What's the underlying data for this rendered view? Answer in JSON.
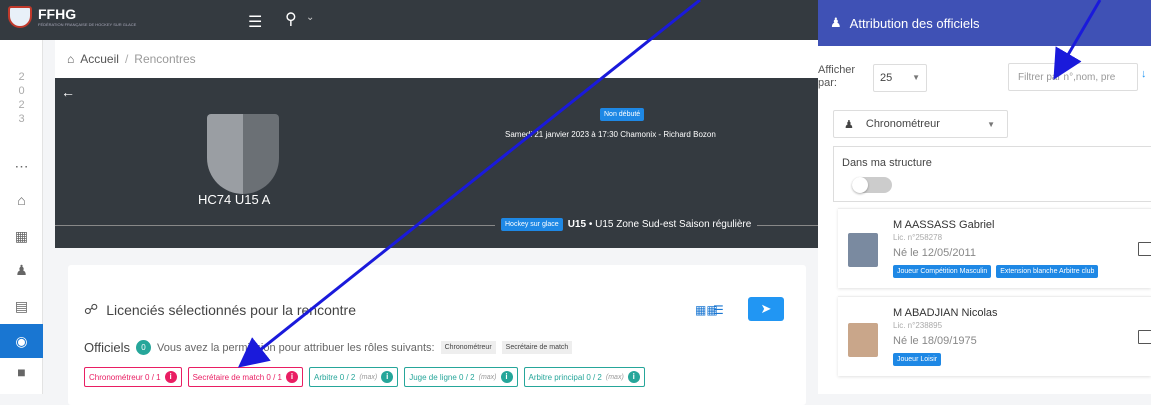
{
  "topbar": {
    "brand": "FFHG",
    "brand_sub": "FÉDÉRATION FRANÇAISE DE HOCKEY SUR GLACE"
  },
  "sidebar": {
    "year_digits": [
      "2",
      "0",
      "2",
      "3"
    ]
  },
  "breadcrumb": {
    "home": "Accueil",
    "separator": "/",
    "current": "Rencontres"
  },
  "match": {
    "status": "Non débuté",
    "info": "Samedi 21 janvier 2023 à 17:30 Chamonix - Richard Bozon",
    "team": "HC74 U15 A",
    "sport": "Hockey sur glace",
    "category_bold": "U15",
    "category_rest": " • U15 Zone Sud-est Saison régulière"
  },
  "card": {
    "title": "Licenciés sélectionnés pour la rencontre",
    "officiels_label": "Officiels",
    "officiels_count": "0",
    "permission_text": "Vous avez la permission pour attribuer les rôles suivants:",
    "allowed_roles": [
      "Chronométreur",
      "Secrétaire de match"
    ],
    "roles": [
      {
        "label": "Chronométreur 0 / 1",
        "max": "",
        "color": "red"
      },
      {
        "label": "Secrétaire de match 0 / 1",
        "max": "",
        "color": "red"
      },
      {
        "label": "Arbitre 0 / 2",
        "max": "(max)",
        "color": "teal"
      },
      {
        "label": "Juge de ligne 0 / 2",
        "max": "(max)",
        "color": "teal"
      },
      {
        "label": "Arbitre principal 0 / 2",
        "max": "(max)",
        "color": "teal"
      }
    ]
  },
  "panel": {
    "title": "Attribution des officiels",
    "afficher_label": "Afficher par:",
    "per_page": "25",
    "filter_placeholder": "Filtrer par n°,nom, pre",
    "role_select": "Chronométreur",
    "structure_label": "Dans ma structure",
    "toggle_on": false,
    "people": [
      {
        "name": "M AASSASS Gabriel",
        "lic": "Lic. n°258278",
        "born": "Né le 12/05/2011",
        "badges": [
          "Joueur Compétition Masculin",
          "Extension blanche Arbitre club"
        ]
      },
      {
        "name": "M ABADJIAN Nicolas",
        "lic": "Lic. n°238895",
        "born": "Né le 18/09/1975",
        "badges": [
          "Joueur Loisir"
        ]
      }
    ]
  },
  "colors": {
    "accent": "#1e88e5",
    "panel_header": "#3f51b5",
    "dark": "#343a40",
    "arrow": "#1a1adb"
  }
}
